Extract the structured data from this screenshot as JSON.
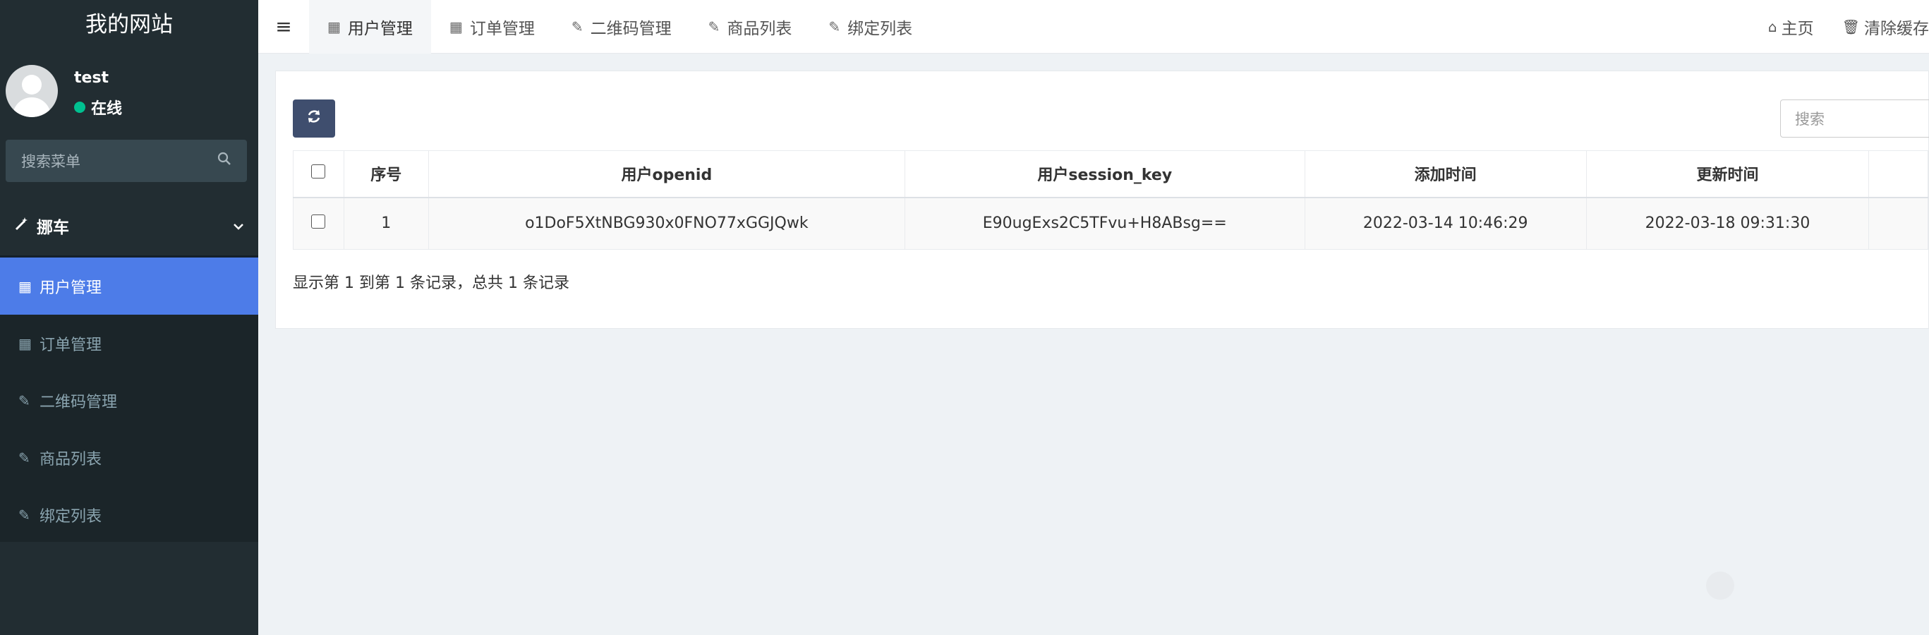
{
  "sidebar": {
    "logo": "我的网站",
    "user": {
      "name": "test",
      "status": "在线",
      "status_color": "#00c090"
    },
    "search_placeholder": "搜索菜单",
    "group": {
      "label": "挪车",
      "icon": "magic-wand-icon"
    },
    "items": [
      {
        "label": "用户管理",
        "icon": "table-icon",
        "active": true
      },
      {
        "label": "订单管理",
        "icon": "table-icon"
      },
      {
        "label": "二维码管理",
        "icon": "edit-icon"
      },
      {
        "label": "商品列表",
        "icon": "edit-icon"
      },
      {
        "label": "绑定列表",
        "icon": "edit-icon"
      }
    ]
  },
  "navbar": {
    "tabs": [
      {
        "label": "用户管理",
        "icon": "table-icon",
        "active": true
      },
      {
        "label": "订单管理",
        "icon": "table-icon"
      },
      {
        "label": "二维码管理",
        "icon": "edit-icon"
      },
      {
        "label": "商品列表",
        "icon": "edit-icon"
      },
      {
        "label": "绑定列表",
        "icon": "edit-icon"
      }
    ],
    "right": {
      "home": "主页",
      "clear_cache": "清除缓存"
    }
  },
  "table": {
    "search_placeholder": "搜索",
    "columns": [
      "序号",
      "用户openid",
      "用户session_key",
      "添加时间",
      "更新时间"
    ],
    "rows": [
      [
        "1",
        "o1DoF5XtNBG930x0FNO77xGGJQwk",
        "E90ugExs2C5TFvu+H8ABsg==",
        "2022-03-14 10:46:29",
        "2022-03-18 09:31:30"
      ]
    ],
    "pagination": "显示第 1 到第 1 条记录，总共 1 条记录"
  },
  "colors": {
    "sidebar_bg": "#222d32",
    "active": "#4d7ce8",
    "refresh_btn": "#3f4e6e"
  }
}
